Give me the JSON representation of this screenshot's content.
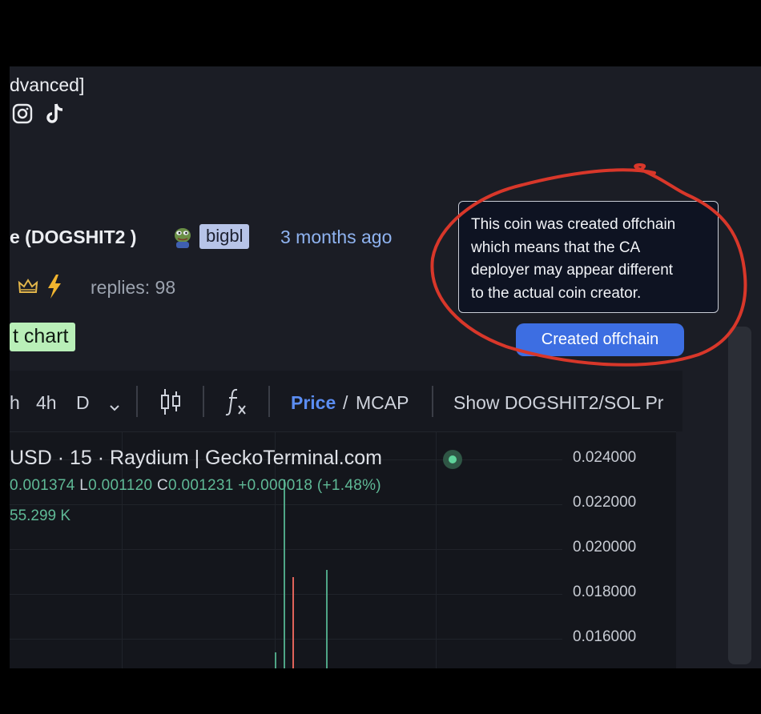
{
  "header": {
    "subtitle_fragment": "dvanced]",
    "social_icons": [
      "instagram-icon",
      "tiktok-icon"
    ]
  },
  "coin": {
    "name_fragment": "e (DOGSHIT2 )",
    "creator": "bigbl",
    "created": "3 months ago",
    "replies": "replies: 98",
    "badge_icons": [
      "crown-icon",
      "lightning-icon"
    ],
    "chart_button": "t chart"
  },
  "tooltip": {
    "lines": [
      "This coin was created offchain",
      "which means that the CA",
      "deployer may appear different",
      "to the actual coin creator."
    ]
  },
  "offchain_button": "Created offchain",
  "chart_toolbar": {
    "interval_partial": "h",
    "interval_4h": "4h",
    "interval_d": "D",
    "price_label": "Price",
    "separator": "/",
    "mcap_label": "MCAP",
    "show_pair": "Show DOGSHIT2/SOL Pr"
  },
  "chart": {
    "title": "USD · 15 · Raydium | GeckoTerminal.com",
    "ohlc": {
      "open_fragment": "0.001374",
      "low_label": "L",
      "low": "0.001120",
      "close_label": "C",
      "close": "0.001231",
      "change": "+0.000018 (+1.48%)"
    },
    "volume": "55.299 K"
  },
  "chart_data": {
    "type": "candlestick",
    "title": "USD · 15 · Raydium | GeckoTerminal.com",
    "y_ticks": [
      "0.024000",
      "0.022000",
      "0.020000",
      "0.018000",
      "0.016000"
    ],
    "ylim": [
      0.0152,
      0.0252
    ],
    "candles": [
      {
        "color": "green",
        "low": 0.0152,
        "high": 0.0159
      },
      {
        "color": "green",
        "low": 0.0152,
        "high": 0.0232
      },
      {
        "color": "red",
        "low": 0.0152,
        "high": 0.0191
      },
      {
        "color": "green",
        "low": 0.0152,
        "high": 0.0194
      }
    ],
    "colors": {
      "up": "#4fa586",
      "down": "#e0635a"
    }
  },
  "colors": {
    "accent": "#3d6ee2",
    "annotation": "#d8372a",
    "badge_bg": "#b7c4e8",
    "chart_chip_bg": "#b9efb8"
  }
}
